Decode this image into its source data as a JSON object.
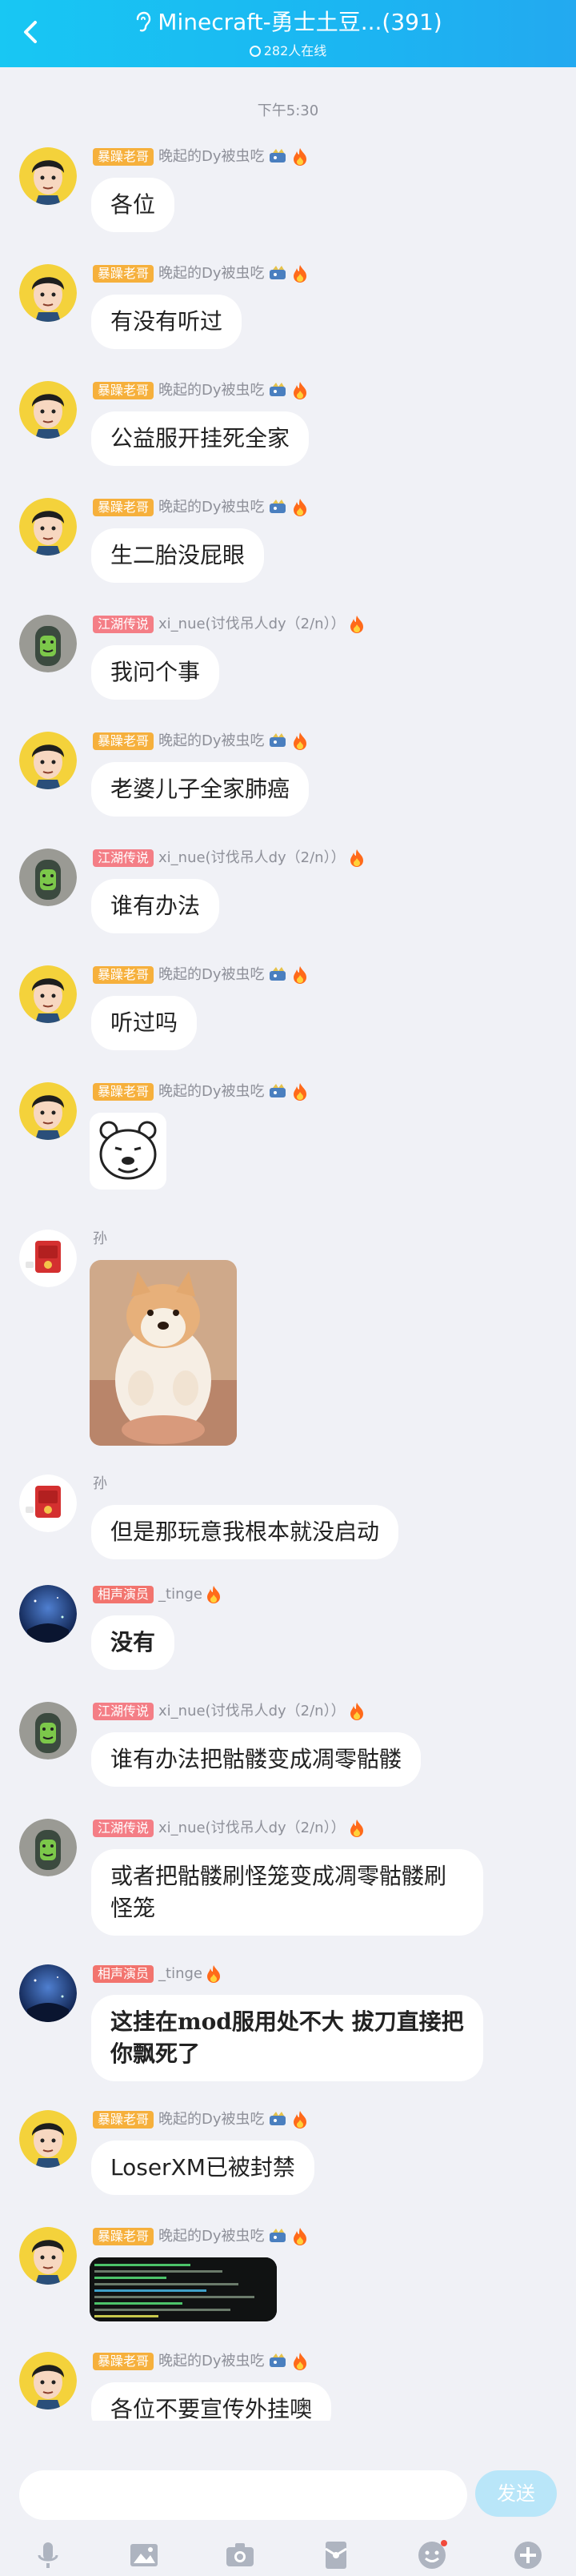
{
  "header": {
    "title": "Minecraft-勇士土豆...(391)",
    "online": "282人在线"
  },
  "chat": {
    "time_divider": "下午5:30",
    "messages": [
      {
        "badge": "暴躁老哥",
        "name": "晚起的Dy被虫吃",
        "text": "各位"
      },
      {
        "badge": "暴躁老哥",
        "name": "晚起的Dy被虫吃",
        "text": "有没有听过"
      },
      {
        "badge": "暴躁老哥",
        "name": "晚起的Dy被虫吃",
        "text": "公益服开挂死全家"
      },
      {
        "badge": "暴躁老哥",
        "name": "晚起的Dy被虫吃",
        "text": "生二胎没屁眼"
      },
      {
        "badge": "江湖传说",
        "name": "xi_nue(讨伐吊人dy（2/n））",
        "text": "我问个事"
      },
      {
        "badge": "暴躁老哥",
        "name": "晚起的Dy被虫吃",
        "text": "老婆儿子全家肺癌"
      },
      {
        "badge": "江湖传说",
        "name": "xi_nue(讨伐吊人dy（2/n））",
        "text": "谁有办法"
      },
      {
        "badge": "暴躁老哥",
        "name": "晚起的Dy被虫吃",
        "text": "听过吗"
      },
      {
        "badge": "暴躁老哥",
        "name": "晚起的Dy被虫吃",
        "text": ""
      },
      {
        "badge": "",
        "name": "孙",
        "text": ""
      },
      {
        "badge": "",
        "name": "孙",
        "text": "但是那玩意我根本就没启动"
      },
      {
        "badge": "相声演员",
        "name": "_tinge",
        "text": "没有"
      },
      {
        "badge": "江湖传说",
        "name": "xi_nue(讨伐吊人dy（2/n））",
        "text": "谁有办法把骷髅变成凋零骷髅"
      },
      {
        "badge": "江湖传说",
        "name": "xi_nue(讨伐吊人dy（2/n））",
        "text": "或者把骷髅刷怪笼变成凋零骷髅刷怪笼"
      },
      {
        "badge": "相声演员",
        "name": "_tinge",
        "text": "这挂在mod服用处不大 拔刀直接把你飘死了"
      },
      {
        "badge": "暴躁老哥",
        "name": "晚起的Dy被虫吃",
        "text": "LoserXM已被封禁"
      },
      {
        "badge": "暴躁老哥",
        "name": "晚起的Dy被虫吃",
        "text": ""
      },
      {
        "badge": "暴躁老哥",
        "name": "晚起的Dy被虫吃",
        "text": "各位不要宣传外挂噢"
      }
    ]
  },
  "input": {
    "placeholder": "",
    "send_label": "发送"
  },
  "colors": {
    "badge_orange": "#f6b03c",
    "badge_pink": "#f47e86",
    "badge_red": "#f2746e",
    "header_start": "#18c7f3",
    "header_end": "#23a9f0"
  },
  "icons": {
    "back": "chevron-left-icon",
    "ear": "ear-icon",
    "fire": "fire-icon",
    "dragon": "dragon-icon",
    "mic": "mic-icon",
    "image": "image-icon",
    "camera": "camera-icon",
    "red_packet": "red-packet-icon",
    "emoji": "emoji-icon",
    "plus": "plus-icon"
  }
}
